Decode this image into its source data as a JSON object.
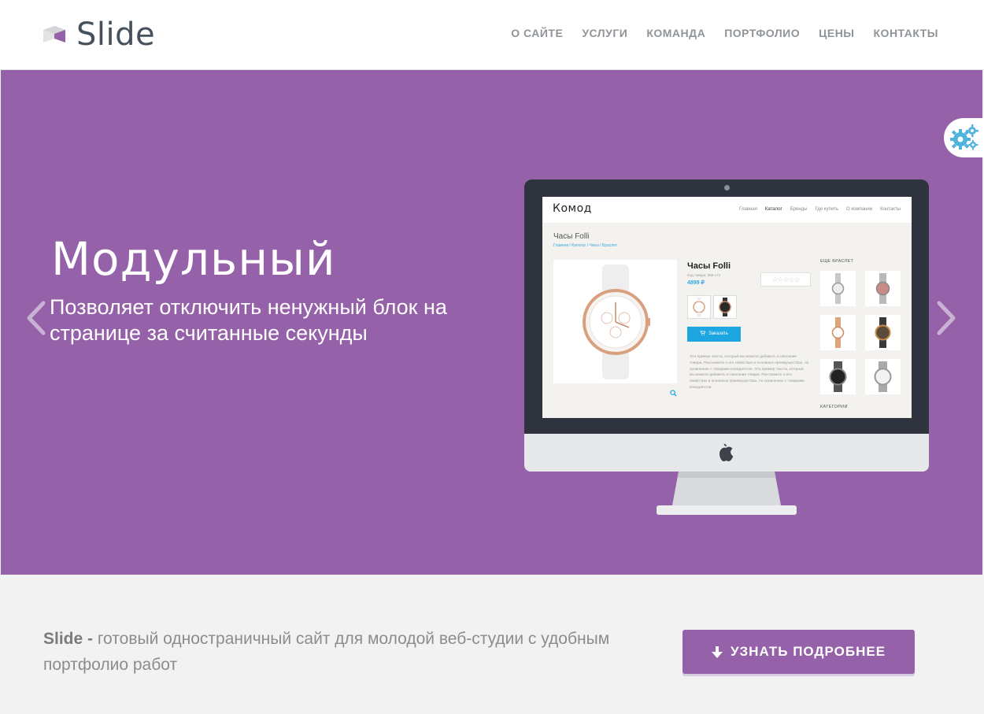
{
  "header": {
    "logo_text": "Slide",
    "nav": [
      "О САЙТЕ",
      "УСЛУГИ",
      "КОМАНДА",
      "ПОРТФОЛИО",
      "ЦЕНЫ",
      "КОНТАКТЫ"
    ]
  },
  "hero": {
    "title": "Модульный",
    "text": "Позволяет отключить ненужный блок на странице за считанные секунды",
    "mockup": {
      "logo": "Комод",
      "nav": [
        "Главная",
        "Каталог",
        "Бренды",
        "Где купить",
        "О компании",
        "Контакты"
      ],
      "page_title": "Часы Folli",
      "breadcrumbs": "Главная / Каталог / Часы / Браслет",
      "product_title": "Часы Folli",
      "product_code": "Код товара: 265-172",
      "price": "4899 ₽",
      "order_button": "Заказать",
      "description": "Это пример текста, который вы можете добавить в описание товара. Расскажите о его свойствах и основных преимуществах, по сравнению с товарами конкурентов. Это пример текста, который вы можете добавить в описание товара. Расскажите о его свойствах и основных преимуществах, по сравнению с товарами конкурентов.",
      "more_heading": "ЕЩЕ БРАСЛЕТ",
      "categories_heading": "КАТЕГОРИИ"
    }
  },
  "strip": {
    "brand": "Slide -",
    "text": " готовый одностраничный сайт для молодой веб-студии с удобным портфолио работ",
    "cta": "УЗНАТЬ ПОДРОБНЕЕ"
  },
  "colors": {
    "accent": "#9561a8",
    "mockup_blue": "#1ea6e2",
    "settings_icon": "#4fb3dd"
  },
  "icons": [
    "cube-logo-icon",
    "arrow-left-icon",
    "arrow-right-icon",
    "gears-icon",
    "arrow-down-icon",
    "apple-icon",
    "zoom-icon",
    "cart-icon"
  ]
}
